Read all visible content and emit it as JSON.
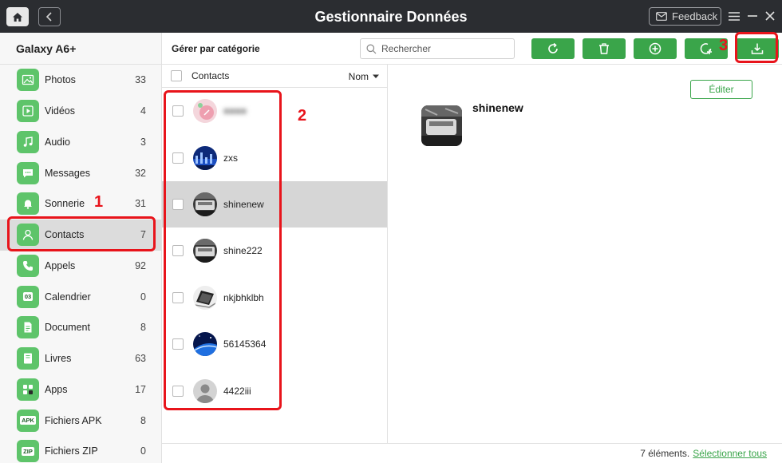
{
  "titlebar": {
    "title": "Gestionnaire Données",
    "feedback_label": "Feedback"
  },
  "sidebar": {
    "device_name": "Galaxy A6+",
    "items": [
      {
        "label": "Photos",
        "count": "33",
        "icon": "photo-icon"
      },
      {
        "label": "Vidéos",
        "count": "4",
        "icon": "video-icon"
      },
      {
        "label": "Audio",
        "count": "3",
        "icon": "music-note-icon"
      },
      {
        "label": "Messages",
        "count": "32",
        "icon": "message-icon"
      },
      {
        "label": "Sonnerie",
        "count": "31",
        "icon": "bell-icon"
      },
      {
        "label": "Contacts",
        "count": "7",
        "icon": "person-icon"
      },
      {
        "label": "Appels",
        "count": "92",
        "icon": "phone-icon"
      },
      {
        "label": "Calendrier",
        "count": "0",
        "icon": "calendar-icon",
        "icon_text": "03"
      },
      {
        "label": "Document",
        "count": "8",
        "icon": "document-icon"
      },
      {
        "label": "Livres",
        "count": "63",
        "icon": "book-icon"
      },
      {
        "label": "Apps",
        "count": "17",
        "icon": "apps-icon"
      },
      {
        "label": "Fichiers APK",
        "count": "8",
        "icon": "apk-file-icon",
        "icon_text": "APK"
      },
      {
        "label": "Fichiers ZIP",
        "count": "0",
        "icon": "zip-file-icon",
        "icon_text": "ZIP"
      }
    ],
    "active_index": 5
  },
  "toolbar": {
    "manage_label": "Gérer par catégorie",
    "search_placeholder": "Rechercher",
    "actions": [
      {
        "name": "refresh-button",
        "icon": "refresh-icon"
      },
      {
        "name": "delete-button",
        "icon": "trash-icon"
      },
      {
        "name": "add-button",
        "icon": "plus-circle-icon"
      },
      {
        "name": "to-device-button",
        "icon": "add-to-device-icon"
      },
      {
        "name": "to-pc-button",
        "icon": "download-to-pc-icon"
      }
    ]
  },
  "list": {
    "header_label": "Contacts",
    "sort_label": "Nom",
    "contacts": [
      {
        "name": "■■■■",
        "blurred": true,
        "avatar": "pink"
      },
      {
        "name": "zxs",
        "avatar": "blue-city"
      },
      {
        "name": "shinenew",
        "avatar": "bw-photo"
      },
      {
        "name": "shine222",
        "avatar": "bw-photo"
      },
      {
        "name": "nkjbhklbh",
        "avatar": "laptop"
      },
      {
        "name": "56145364",
        "avatar": "blue-earth"
      },
      {
        "name": "4422iii",
        "avatar": "default-person"
      }
    ],
    "selected_index": 2
  },
  "detail": {
    "edit_label": "Éditer",
    "name": "shinenew"
  },
  "status": {
    "count_text": "7 éléments.",
    "select_all_label": "Sélectionner tous"
  },
  "annotations": {
    "n1": "1",
    "n2": "2",
    "n3": "3"
  },
  "colors": {
    "accent_green": "#3aa54a",
    "titlebar_bg": "#2b2d31",
    "annotation_red": "#e8141b"
  }
}
